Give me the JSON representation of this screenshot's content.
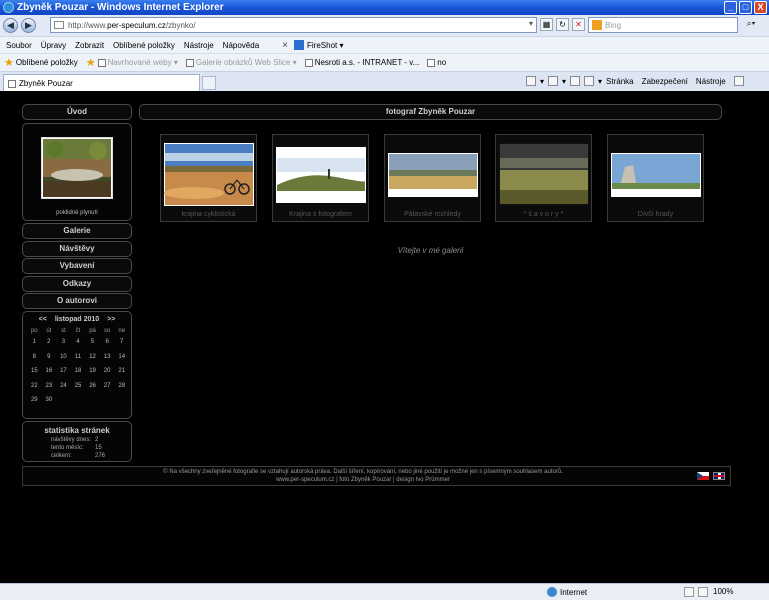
{
  "window": {
    "title": "Zbyněk Pouzar - Windows Internet Explorer",
    "buttons": [
      "_",
      "□",
      "X"
    ]
  },
  "address_bar": {
    "url_prefix": "http://www.",
    "url_domain": "per-speculum.cz",
    "url_suffix": "/zbynko/",
    "search_placeholder": "Bing"
  },
  "menu": {
    "items": [
      "Soubor",
      "Úpravy",
      "Zobrazit",
      "Oblíbené položky",
      "Nástroje",
      "Nápověda"
    ],
    "close": "×",
    "fireshot": "FireShot"
  },
  "favorites_bar": {
    "favorites_label": "Oblíbené položky",
    "items": [
      "Navrhované weby",
      "Galerie obrázků Web Slice",
      "Nesroti a.s. - INTRANET - v...",
      "no"
    ]
  },
  "tab": {
    "title": "Zbyněk Pouzar"
  },
  "command_bar": {
    "page": "Stránka",
    "safety": "Zabezpečení",
    "tools": "Nástroje"
  },
  "sidebar": {
    "home": "Úvod",
    "featured_caption": "poklidné plynutí",
    "nav": [
      "Galerie",
      "Návštěvy",
      "Vybavení",
      "Odkazy",
      "O autorovi"
    ]
  },
  "calendar": {
    "prev": "<<",
    "month": "listopad 2010",
    "next": ">>",
    "day_names": [
      "po",
      "út",
      "st",
      "čt",
      "pá",
      "so",
      "ne"
    ],
    "days": [
      "1",
      "2",
      "3",
      "4",
      "5",
      "6",
      "7",
      "8",
      "9",
      "10",
      "11",
      "12",
      "13",
      "14",
      "15",
      "16",
      "17",
      "18",
      "19",
      "20",
      "21",
      "22",
      "23",
      "24",
      "25",
      "26",
      "27",
      "28",
      "29",
      "30"
    ]
  },
  "stats": {
    "title": "statistika stránek",
    "rows": [
      {
        "label": "návštěvy dnes:",
        "value": "2"
      },
      {
        "label": "tento měsíc:",
        "value": "15"
      },
      {
        "label": "celkem:",
        "value": "276"
      }
    ]
  },
  "main": {
    "header": "fotograf Zbyněk Pouzar",
    "galleries": [
      {
        "label": "krajina cyklistická"
      },
      {
        "label": "Krajina s fotografem"
      },
      {
        "label": "Pálavské rozhledy"
      },
      {
        "label": "* š a v o r y *"
      },
      {
        "label": "Dívčí hrady"
      }
    ],
    "welcome": "Vítejte v mé galerii"
  },
  "footer": {
    "line1": "© Na všechny zveřejněné fotografie se vztahují autorská práva. Další šíření, kopírování, nebo jiné použití je možné jen s písemným souhlasem autorů.",
    "line2": "www.per-speculum.cz | foto Zbyněk Pouzar | design Ivo Prümmer"
  },
  "status_bar": {
    "zone": "Internet",
    "zoom": "100%"
  },
  "colors": {
    "page_bg": "#000000",
    "panel_border": "#4a4a4a",
    "ie_titlebar": "#1a56d6"
  }
}
